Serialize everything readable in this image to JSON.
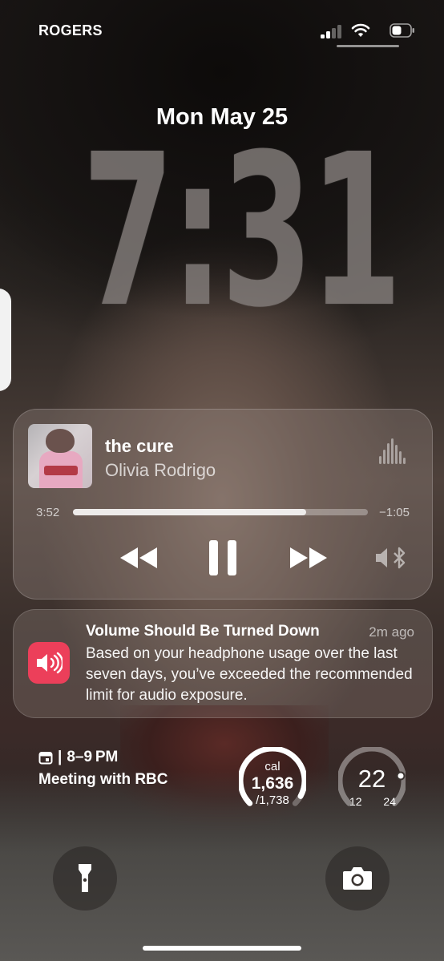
{
  "status_bar": {
    "carrier": "ROGERS",
    "signal_icon": "cellular-signal-icon",
    "wifi_icon": "wifi-icon",
    "battery_icon": "battery-icon"
  },
  "lock_screen": {
    "date": "Mon May 25",
    "time": "7:31"
  },
  "now_playing": {
    "track": "the cure",
    "artist": "Olivia Rodrigo",
    "elapsed": "3:52",
    "remaining": "−1:05",
    "progress": 0.79,
    "icons": [
      "rewind-icon",
      "pause-icon",
      "fast-forward-icon",
      "audio-output-icon",
      "waveform-icon"
    ]
  },
  "notification": {
    "title": "Volume Should Be Turned Down",
    "time": "2m ago",
    "body": "Based on your headphone usage over the last seven days, you’ve exceeded the recommended limit for audio exposure.",
    "icon": "speaker-volume-icon",
    "icon_color": "#EC3F5A"
  },
  "widgets": {
    "calendar": {
      "time_range": "8–9 PM",
      "event": "Meeting with RBC"
    },
    "calories": {
      "unit": "cal",
      "value": "1,636",
      "goal": "/1,738",
      "progress": 0.94
    },
    "temperature": {
      "current": "22",
      "low": "12",
      "high": "24"
    }
  },
  "buttons": {
    "flashlight_icon": "flashlight-icon",
    "camera_icon": "camera-icon"
  }
}
